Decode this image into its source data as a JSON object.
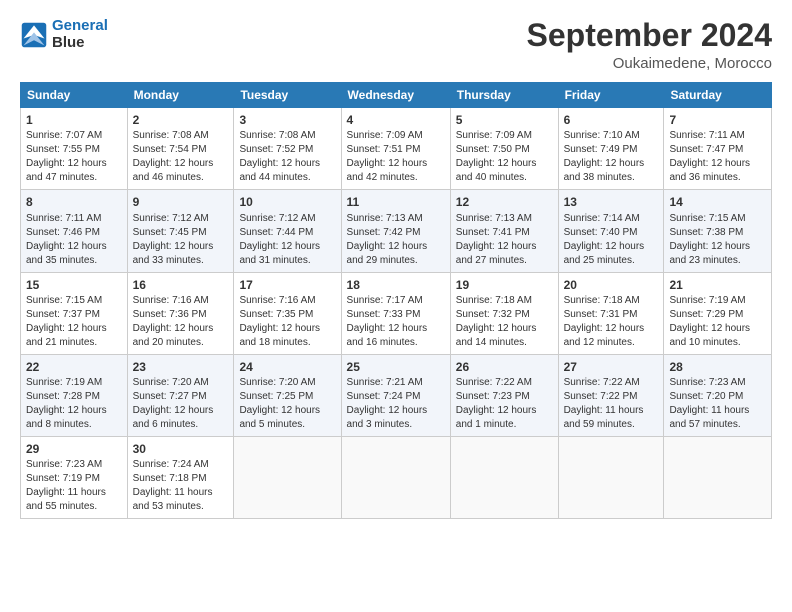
{
  "header": {
    "logo_line1": "General",
    "logo_line2": "Blue",
    "month_title": "September 2024",
    "location": "Oukaimedene, Morocco"
  },
  "days_of_week": [
    "Sunday",
    "Monday",
    "Tuesday",
    "Wednesday",
    "Thursday",
    "Friday",
    "Saturday"
  ],
  "weeks": [
    [
      {
        "day": "1",
        "info": "Sunrise: 7:07 AM\nSunset: 7:55 PM\nDaylight: 12 hours\nand 47 minutes."
      },
      {
        "day": "2",
        "info": "Sunrise: 7:08 AM\nSunset: 7:54 PM\nDaylight: 12 hours\nand 46 minutes."
      },
      {
        "day": "3",
        "info": "Sunrise: 7:08 AM\nSunset: 7:52 PM\nDaylight: 12 hours\nand 44 minutes."
      },
      {
        "day": "4",
        "info": "Sunrise: 7:09 AM\nSunset: 7:51 PM\nDaylight: 12 hours\nand 42 minutes."
      },
      {
        "day": "5",
        "info": "Sunrise: 7:09 AM\nSunset: 7:50 PM\nDaylight: 12 hours\nand 40 minutes."
      },
      {
        "day": "6",
        "info": "Sunrise: 7:10 AM\nSunset: 7:49 PM\nDaylight: 12 hours\nand 38 minutes."
      },
      {
        "day": "7",
        "info": "Sunrise: 7:11 AM\nSunset: 7:47 PM\nDaylight: 12 hours\nand 36 minutes."
      }
    ],
    [
      {
        "day": "8",
        "info": "Sunrise: 7:11 AM\nSunset: 7:46 PM\nDaylight: 12 hours\nand 35 minutes."
      },
      {
        "day": "9",
        "info": "Sunrise: 7:12 AM\nSunset: 7:45 PM\nDaylight: 12 hours\nand 33 minutes."
      },
      {
        "day": "10",
        "info": "Sunrise: 7:12 AM\nSunset: 7:44 PM\nDaylight: 12 hours\nand 31 minutes."
      },
      {
        "day": "11",
        "info": "Sunrise: 7:13 AM\nSunset: 7:42 PM\nDaylight: 12 hours\nand 29 minutes."
      },
      {
        "day": "12",
        "info": "Sunrise: 7:13 AM\nSunset: 7:41 PM\nDaylight: 12 hours\nand 27 minutes."
      },
      {
        "day": "13",
        "info": "Sunrise: 7:14 AM\nSunset: 7:40 PM\nDaylight: 12 hours\nand 25 minutes."
      },
      {
        "day": "14",
        "info": "Sunrise: 7:15 AM\nSunset: 7:38 PM\nDaylight: 12 hours\nand 23 minutes."
      }
    ],
    [
      {
        "day": "15",
        "info": "Sunrise: 7:15 AM\nSunset: 7:37 PM\nDaylight: 12 hours\nand 21 minutes."
      },
      {
        "day": "16",
        "info": "Sunrise: 7:16 AM\nSunset: 7:36 PM\nDaylight: 12 hours\nand 20 minutes."
      },
      {
        "day": "17",
        "info": "Sunrise: 7:16 AM\nSunset: 7:35 PM\nDaylight: 12 hours\nand 18 minutes."
      },
      {
        "day": "18",
        "info": "Sunrise: 7:17 AM\nSunset: 7:33 PM\nDaylight: 12 hours\nand 16 minutes."
      },
      {
        "day": "19",
        "info": "Sunrise: 7:18 AM\nSunset: 7:32 PM\nDaylight: 12 hours\nand 14 minutes."
      },
      {
        "day": "20",
        "info": "Sunrise: 7:18 AM\nSunset: 7:31 PM\nDaylight: 12 hours\nand 12 minutes."
      },
      {
        "day": "21",
        "info": "Sunrise: 7:19 AM\nSunset: 7:29 PM\nDaylight: 12 hours\nand 10 minutes."
      }
    ],
    [
      {
        "day": "22",
        "info": "Sunrise: 7:19 AM\nSunset: 7:28 PM\nDaylight: 12 hours\nand 8 minutes."
      },
      {
        "day": "23",
        "info": "Sunrise: 7:20 AM\nSunset: 7:27 PM\nDaylight: 12 hours\nand 6 minutes."
      },
      {
        "day": "24",
        "info": "Sunrise: 7:20 AM\nSunset: 7:25 PM\nDaylight: 12 hours\nand 5 minutes."
      },
      {
        "day": "25",
        "info": "Sunrise: 7:21 AM\nSunset: 7:24 PM\nDaylight: 12 hours\nand 3 minutes."
      },
      {
        "day": "26",
        "info": "Sunrise: 7:22 AM\nSunset: 7:23 PM\nDaylight: 12 hours\nand 1 minute."
      },
      {
        "day": "27",
        "info": "Sunrise: 7:22 AM\nSunset: 7:22 PM\nDaylight: 11 hours\nand 59 minutes."
      },
      {
        "day": "28",
        "info": "Sunrise: 7:23 AM\nSunset: 7:20 PM\nDaylight: 11 hours\nand 57 minutes."
      }
    ],
    [
      {
        "day": "29",
        "info": "Sunrise: 7:23 AM\nSunset: 7:19 PM\nDaylight: 11 hours\nand 55 minutes."
      },
      {
        "day": "30",
        "info": "Sunrise: 7:24 AM\nSunset: 7:18 PM\nDaylight: 11 hours\nand 53 minutes."
      },
      {
        "day": "",
        "info": ""
      },
      {
        "day": "",
        "info": ""
      },
      {
        "day": "",
        "info": ""
      },
      {
        "day": "",
        "info": ""
      },
      {
        "day": "",
        "info": ""
      }
    ]
  ]
}
